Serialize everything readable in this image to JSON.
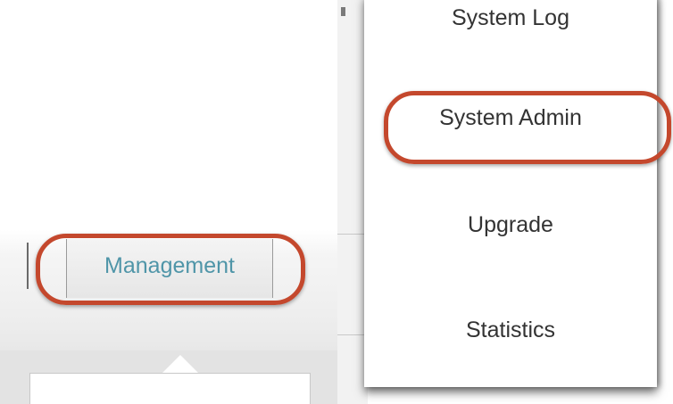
{
  "nav": {
    "management_label": "Management"
  },
  "menu": {
    "items": [
      {
        "label": "System Log"
      },
      {
        "label": "System Admin"
      },
      {
        "label": "Upgrade"
      },
      {
        "label": "Statistics"
      }
    ],
    "highlighted_item": "System Admin"
  },
  "colors": {
    "highlight_ring": "#c4482d",
    "management_text": "#4f95a8",
    "menu_text": "#333333"
  }
}
